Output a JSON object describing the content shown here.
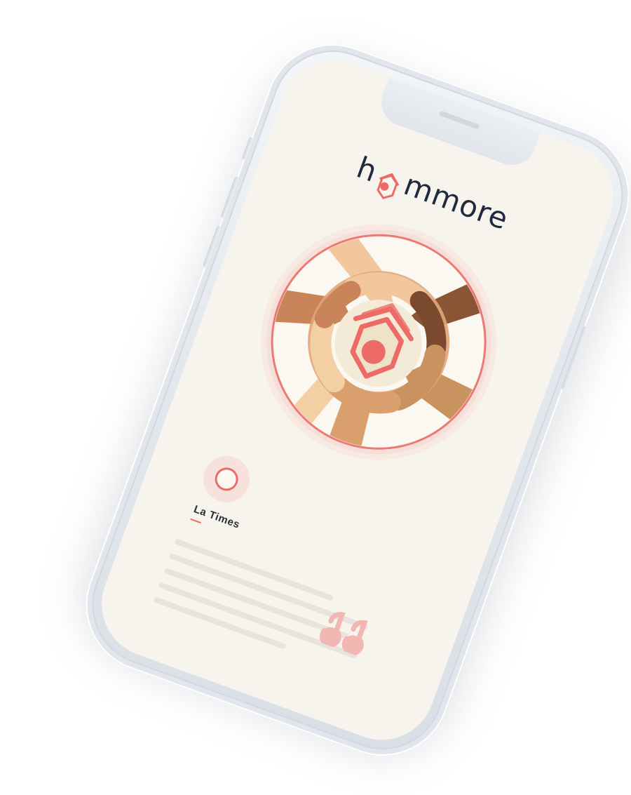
{
  "app": {
    "logo_text_prefix": "h",
    "logo_text_suffix": "mmore",
    "logo_icon": "home-pin-icon"
  },
  "hero": {
    "icon": "hands-circle-home-illustration"
  },
  "testimonial": {
    "source_name": "La Times",
    "quote_icon": "quote-icon"
  },
  "colors": {
    "accent": "#ec6b67",
    "screen_bg": "#f6f4ec",
    "text_dark": "#1f2a3d",
    "placeholder_line": "#e9e3de",
    "quote": "#f2b6b3"
  }
}
